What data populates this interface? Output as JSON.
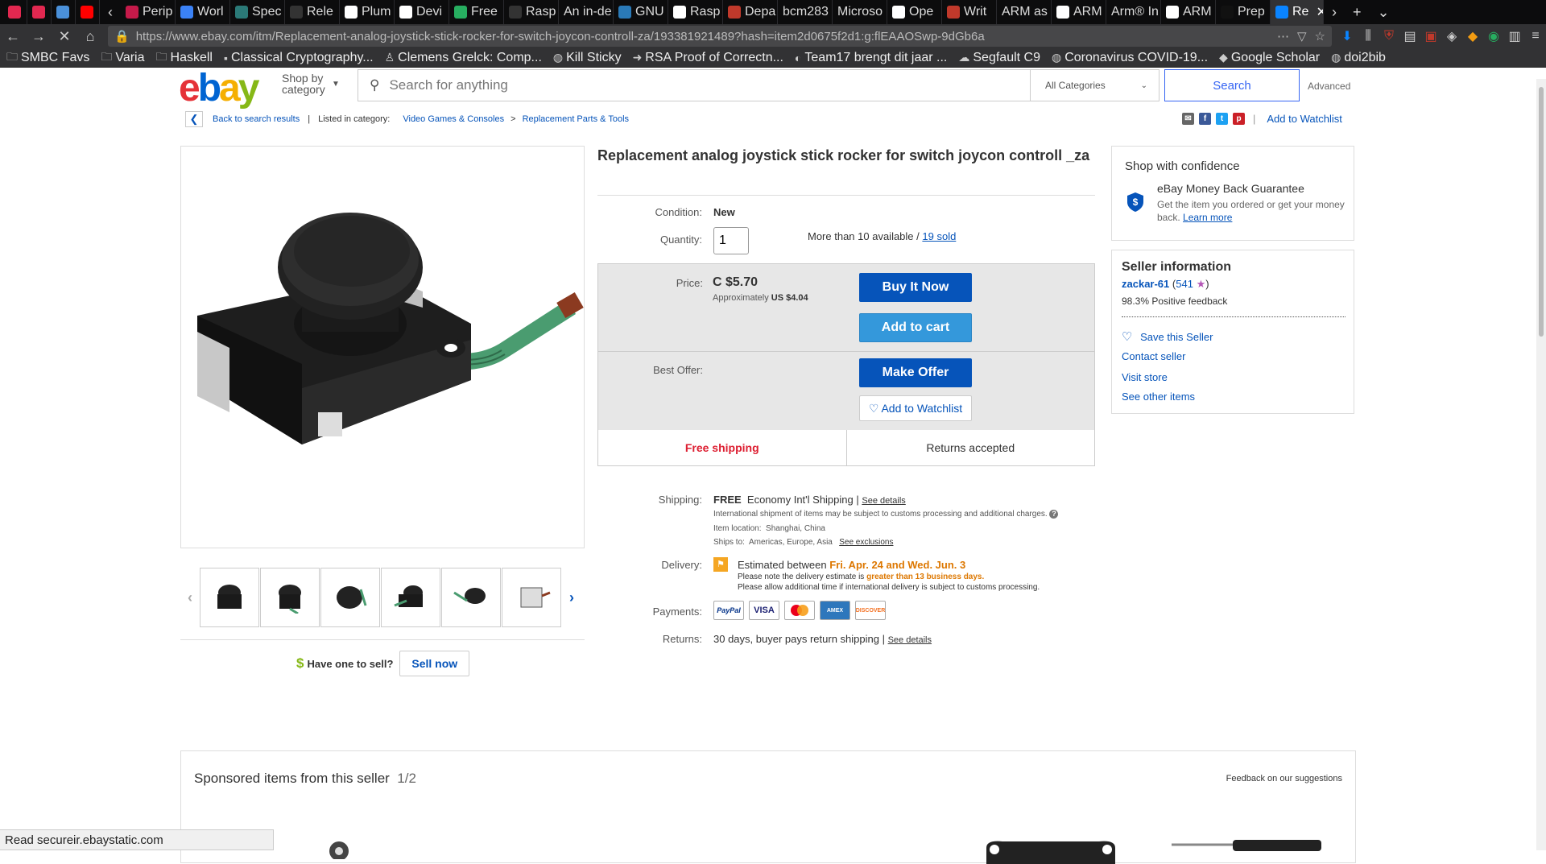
{
  "browser": {
    "tabs": [
      {
        "label": "",
        "color": "#e22850"
      },
      {
        "label": "",
        "color": "#e22850"
      },
      {
        "label": "",
        "color": "#4a90d9"
      },
      {
        "label": "",
        "color": "#ff0000"
      },
      {
        "label": "Perip",
        "color": "#c51a4a"
      },
      {
        "label": "Worl",
        "color": "#3b82f6"
      },
      {
        "label": "Spec",
        "color": "#2b7a78"
      },
      {
        "label": "Rele",
        "color": "#333333"
      },
      {
        "label": "Plum",
        "color": "#ffffff"
      },
      {
        "label": "Devi",
        "color": "#ffffff"
      },
      {
        "label": "Free",
        "color": "#27ae60"
      },
      {
        "label": "Rasp",
        "color": "#333333"
      },
      {
        "label": "An in-de",
        "color": ""
      },
      {
        "label": "GNU",
        "color": "#2a7ab8"
      },
      {
        "label": "Rasp",
        "color": "#ffffff"
      },
      {
        "label": "Depa",
        "color": "#c0392b"
      },
      {
        "label": "bcm283",
        "color": ""
      },
      {
        "label": "Microso",
        "color": ""
      },
      {
        "label": "Ope",
        "color": "#ffffff"
      },
      {
        "label": "Writ",
        "color": "#c0392b"
      },
      {
        "label": "ARM as",
        "color": ""
      },
      {
        "label": "ARM",
        "color": "#ffffff"
      },
      {
        "label": "Arm® In",
        "color": ""
      },
      {
        "label": "ARM",
        "color": "#ffffff"
      },
      {
        "label": "Prep",
        "color": "#111111"
      },
      {
        "label": "Re",
        "color": "#0a84ff"
      }
    ],
    "url": "https://www.ebay.com/itm/Replacement-analog-joystick-stick-rocker-for-switch-joycon-controll-za/193381921489?hash=item2d0675f2d1:g:flEAAOSwp-9dGb6a",
    "bookmarks": [
      {
        "label": "SMBC Favs",
        "icon": "folder-icon"
      },
      {
        "label": "Varia",
        "icon": "folder-icon"
      },
      {
        "label": "Haskell",
        "icon": "folder-icon"
      },
      {
        "label": "Classical Cryptography...",
        "icon": "ebay-icon"
      },
      {
        "label": "Clemens Grelck: Comp...",
        "icon": "person-icon"
      },
      {
        "label": "Kill Sticky",
        "icon": "globe-icon"
      },
      {
        "label": "RSA Proof of Correctn...",
        "icon": "arrow-icon"
      },
      {
        "label": "Team17 brengt dit jaar ...",
        "icon": "news-icon"
      },
      {
        "label": "Segfault C9",
        "icon": "cloud-icon"
      },
      {
        "label": "Coronavirus COVID-19...",
        "icon": "globe-icon"
      },
      {
        "label": "Google Scholar",
        "icon": "scholar-icon"
      },
      {
        "label": "doi2bib",
        "icon": "globe-icon"
      }
    ],
    "status": "Read secureir.ebaystatic.com"
  },
  "header": {
    "logo": {
      "e": "e",
      "b": "b",
      "a": "a",
      "y": "y"
    },
    "shop_by": "Shop by",
    "category": "category",
    "search_placeholder": "Search for anything",
    "category_select": "All Categories",
    "search_button": "Search",
    "advanced": "Advanced"
  },
  "breadcrumb": {
    "back": "Back to search results",
    "listed_in": "Listed in category:",
    "cat1": "Video Games & Consoles",
    "sep": ">",
    "cat2": "Replacement Parts & Tools",
    "watchlist": "Add to Watchlist"
  },
  "item": {
    "title": "Replacement analog joystick stick rocker for switch joycon controll _za",
    "condition_label": "Condition:",
    "condition": "New",
    "quantity_label": "Quantity:",
    "quantity": "1",
    "availability": "More than 10 available /",
    "sold": "19 sold",
    "price_label": "Price:",
    "price": "C $5.70",
    "approx_label": "Approximately",
    "approx_value": "US $4.04",
    "buy_now": "Buy It Now",
    "add_cart": "Add to cart",
    "best_offer_label": "Best Offer:",
    "make_offer": "Make Offer",
    "add_watchlist": "Add to Watchlist",
    "free_shipping": "Free shipping",
    "returns_accepted": "Returns accepted",
    "shipping_label": "Shipping:",
    "shipping_free": "FREE",
    "shipping_method": "Economy Int'l Shipping",
    "see_details": "See details",
    "intl_note": "International shipment of items may be subject to customs processing and additional charges.",
    "item_location": "Item location:",
    "location": "Shanghai, China",
    "ships_to": "Ships to:",
    "ships_to_value": "Americas, Europe, Asia",
    "see_exclusions": "See exclusions",
    "delivery_label": "Delivery:",
    "delivery_est": "Estimated between",
    "delivery_dates": "Fri. Apr. 24 and Wed. Jun. 3",
    "delivery_note1": "Please note the delivery estimate is",
    "delivery_note1_bold": "greater than 13 business days.",
    "delivery_note2": "Please allow additional time if international delivery is subject to customs processing.",
    "payments_label": "Payments:",
    "payments": [
      "PayPal",
      "VISA",
      "MC",
      "AMEX",
      "DISCOVER"
    ],
    "returns_label": "Returns:",
    "returns": "30 days, buyer pays return shipping",
    "returns_details": "See details"
  },
  "confidence": {
    "title": "Shop with confidence",
    "guarantee": "eBay Money Back Guarantee",
    "desc": "Get the item you ordered or get your money back.",
    "learn": "Learn more"
  },
  "seller": {
    "title": "Seller information",
    "name": "zackar-61",
    "score": "541",
    "feedback": "98.3% Positive feedback",
    "save": "Save this Seller",
    "contact": "Contact seller",
    "visit": "Visit store",
    "other": "See other items"
  },
  "sell": {
    "question": "Have one to sell?",
    "button": "Sell now"
  },
  "sponsored": {
    "title": "Sponsored items from this seller",
    "page": "1/2",
    "feedback": "Feedback on our suggestions"
  }
}
